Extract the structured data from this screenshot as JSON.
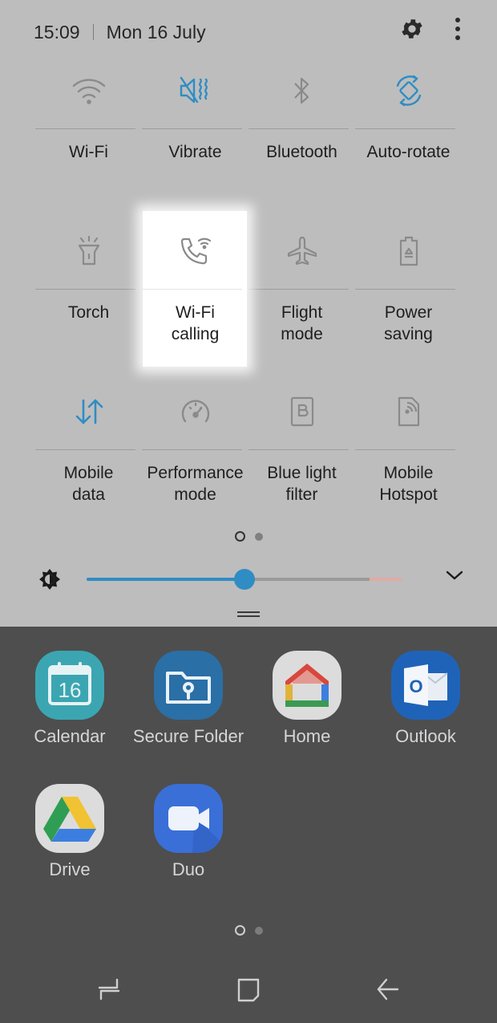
{
  "status": {
    "time": "15:09",
    "date": "Mon 16 July"
  },
  "top_icons": [
    "gear-icon",
    "more-vert-icon"
  ],
  "tiles": [
    [
      {
        "label": "Wi-Fi",
        "icon": "wifi-icon",
        "active": false
      },
      {
        "label": "Vibrate",
        "icon": "vibrate-icon",
        "active": true
      },
      {
        "label": "Bluetooth",
        "icon": "bluetooth-icon",
        "active": false
      },
      {
        "label": "Auto-rotate",
        "icon": "auto-rotate-icon",
        "active": true
      }
    ],
    [
      {
        "label": "Torch",
        "icon": "torch-icon",
        "active": false
      },
      {
        "label": "Wi-Fi calling",
        "label_lines": [
          "Wi-Fi",
          "calling"
        ],
        "icon": "wifi-calling-icon",
        "active": false,
        "highlighted": true
      },
      {
        "label": "Flight mode",
        "label_lines": [
          "Flight",
          "mode"
        ],
        "icon": "airplane-icon",
        "active": false
      },
      {
        "label": "Power saving",
        "label_lines": [
          "Power",
          "saving"
        ],
        "icon": "battery-saver-icon",
        "active": false
      }
    ],
    [
      {
        "label": "Mobile data",
        "label_lines": [
          "Mobile",
          "data"
        ],
        "icon": "mobile-data-icon",
        "active": true
      },
      {
        "label": "Performance mode",
        "label_lines": [
          "Performance",
          "mode"
        ],
        "icon": "gauge-icon",
        "active": false
      },
      {
        "label": "Blue light filter",
        "label_lines": [
          "Blue light",
          "filter"
        ],
        "icon": "blue-light-filter-icon",
        "active": false
      },
      {
        "label": "Mobile Hotspot",
        "label_lines": [
          "Mobile",
          "Hotspot"
        ],
        "icon": "hotspot-icon",
        "active": false
      }
    ]
  ],
  "panel_pager": {
    "pages": 2,
    "current": 1
  },
  "brightness": {
    "level": 0.5,
    "icon": "brightness-icon"
  },
  "apps": [
    {
      "name": "Calendar",
      "icon": "calendar-icon",
      "badge": "16"
    },
    {
      "name": "Secure Folder",
      "icon": "secure-folder-icon"
    },
    {
      "name": "Home",
      "icon": "google-home-icon"
    },
    {
      "name": "Outlook",
      "icon": "outlook-icon",
      "badge": "O"
    },
    {
      "name": "Drive",
      "icon": "google-drive-icon"
    },
    {
      "name": "Duo",
      "icon": "duo-icon"
    }
  ],
  "apps_pager": {
    "pages": 2,
    "current": 1
  },
  "navbar": [
    "recents-icon",
    "home-icon",
    "back-icon"
  ],
  "colors": {
    "accent": "#2f8dc4",
    "panel_bg": "#bdbdbd",
    "drawer_bg": "#4e4e4e",
    "icon_inactive": "#8a8a8a"
  }
}
